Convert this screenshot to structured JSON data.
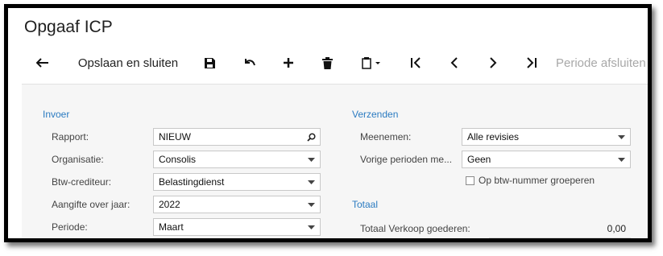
{
  "window": {
    "title": "Opgaaf ICP"
  },
  "toolbar": {
    "back_icon": "back-arrow-icon",
    "save_close_label": "Opslaan en sluiten",
    "save_icon": "floppy-disk-icon",
    "undo_icon": "undo-icon",
    "add_icon": "plus-icon",
    "delete_icon": "trash-icon",
    "clipboard_icon": "clipboard-icon",
    "first_icon": "first-record-icon",
    "prev_icon": "previous-record-icon",
    "next_icon": "next-record-icon",
    "last_icon": "last-record-icon",
    "close_period_label": "Periode afsluiten"
  },
  "invoer": {
    "title": "Invoer",
    "rapport": {
      "label": "Rapport:",
      "value": "NIEUW"
    },
    "organisatie": {
      "label": "Organisatie:",
      "value": "Consolis"
    },
    "btw_crediteur": {
      "label": "Btw-crediteur:",
      "value": "Belastingdienst"
    },
    "aangifte_jaar": {
      "label": "Aangifte over jaar:",
      "value": "2022"
    },
    "periode": {
      "label": "Periode:",
      "value": "Maart"
    }
  },
  "verzenden": {
    "title": "Verzenden",
    "meenemen": {
      "label": "Meenemen:",
      "value": "Alle revisies"
    },
    "vorige_perioden": {
      "label": "Vorige perioden me...",
      "value": "Geen"
    },
    "groeperen": {
      "label": "Op btw-nummer groeperen",
      "checked": false
    }
  },
  "totaal": {
    "title": "Totaal",
    "verkoop_goederen": {
      "label": "Totaal Verkoop goederen:",
      "value": "0,00"
    }
  },
  "colors": {
    "section_title": "#2b7bc1",
    "panel_bg": "#f6f6f6",
    "disabled_text": "#a8a8a8"
  }
}
